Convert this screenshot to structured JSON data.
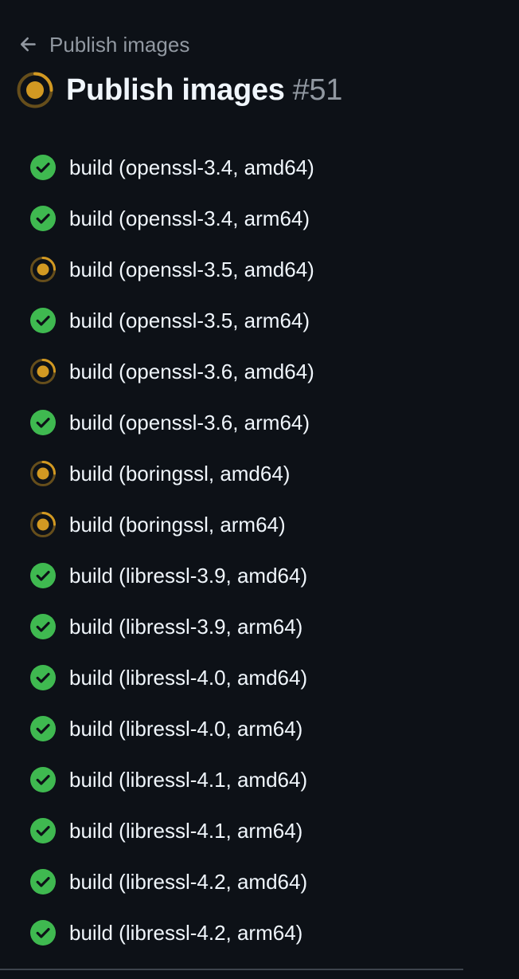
{
  "header": {
    "back_label": "Publish images",
    "title": "Publish images",
    "run_number": "#51",
    "status": "in-progress-icon"
  },
  "colors": {
    "background": "#0d1117",
    "success": "#3fb950",
    "in_progress": "#d29922",
    "text": "#f0f6fc",
    "muted": "#9198a1"
  },
  "jobs": [
    {
      "label": "build (openssl-3.4, amd64)",
      "status": "success",
      "icon": "check-circle-icon"
    },
    {
      "label": "build (openssl-3.4, arm64)",
      "status": "success",
      "icon": "check-circle-icon"
    },
    {
      "label": "build (openssl-3.5, amd64)",
      "status": "in_progress",
      "icon": "in-progress-icon"
    },
    {
      "label": "build (openssl-3.5, arm64)",
      "status": "success",
      "icon": "check-circle-icon"
    },
    {
      "label": "build (openssl-3.6, amd64)",
      "status": "in_progress",
      "icon": "in-progress-icon"
    },
    {
      "label": "build (openssl-3.6, arm64)",
      "status": "success",
      "icon": "check-circle-icon"
    },
    {
      "label": "build (boringssl, amd64)",
      "status": "in_progress",
      "icon": "in-progress-icon"
    },
    {
      "label": "build (boringssl, arm64)",
      "status": "in_progress",
      "icon": "in-progress-icon"
    },
    {
      "label": "build (libressl-3.9, amd64)",
      "status": "success",
      "icon": "check-circle-icon"
    },
    {
      "label": "build (libressl-3.9, arm64)",
      "status": "success",
      "icon": "check-circle-icon"
    },
    {
      "label": "build (libressl-4.0, amd64)",
      "status": "success",
      "icon": "check-circle-icon"
    },
    {
      "label": "build (libressl-4.0, arm64)",
      "status": "success",
      "icon": "check-circle-icon"
    },
    {
      "label": "build (libressl-4.1, amd64)",
      "status": "success",
      "icon": "check-circle-icon"
    },
    {
      "label": "build (libressl-4.1, arm64)",
      "status": "success",
      "icon": "check-circle-icon"
    },
    {
      "label": "build (libressl-4.2, amd64)",
      "status": "success",
      "icon": "check-circle-icon"
    },
    {
      "label": "build (libressl-4.2, arm64)",
      "status": "success",
      "icon": "check-circle-icon"
    }
  ]
}
